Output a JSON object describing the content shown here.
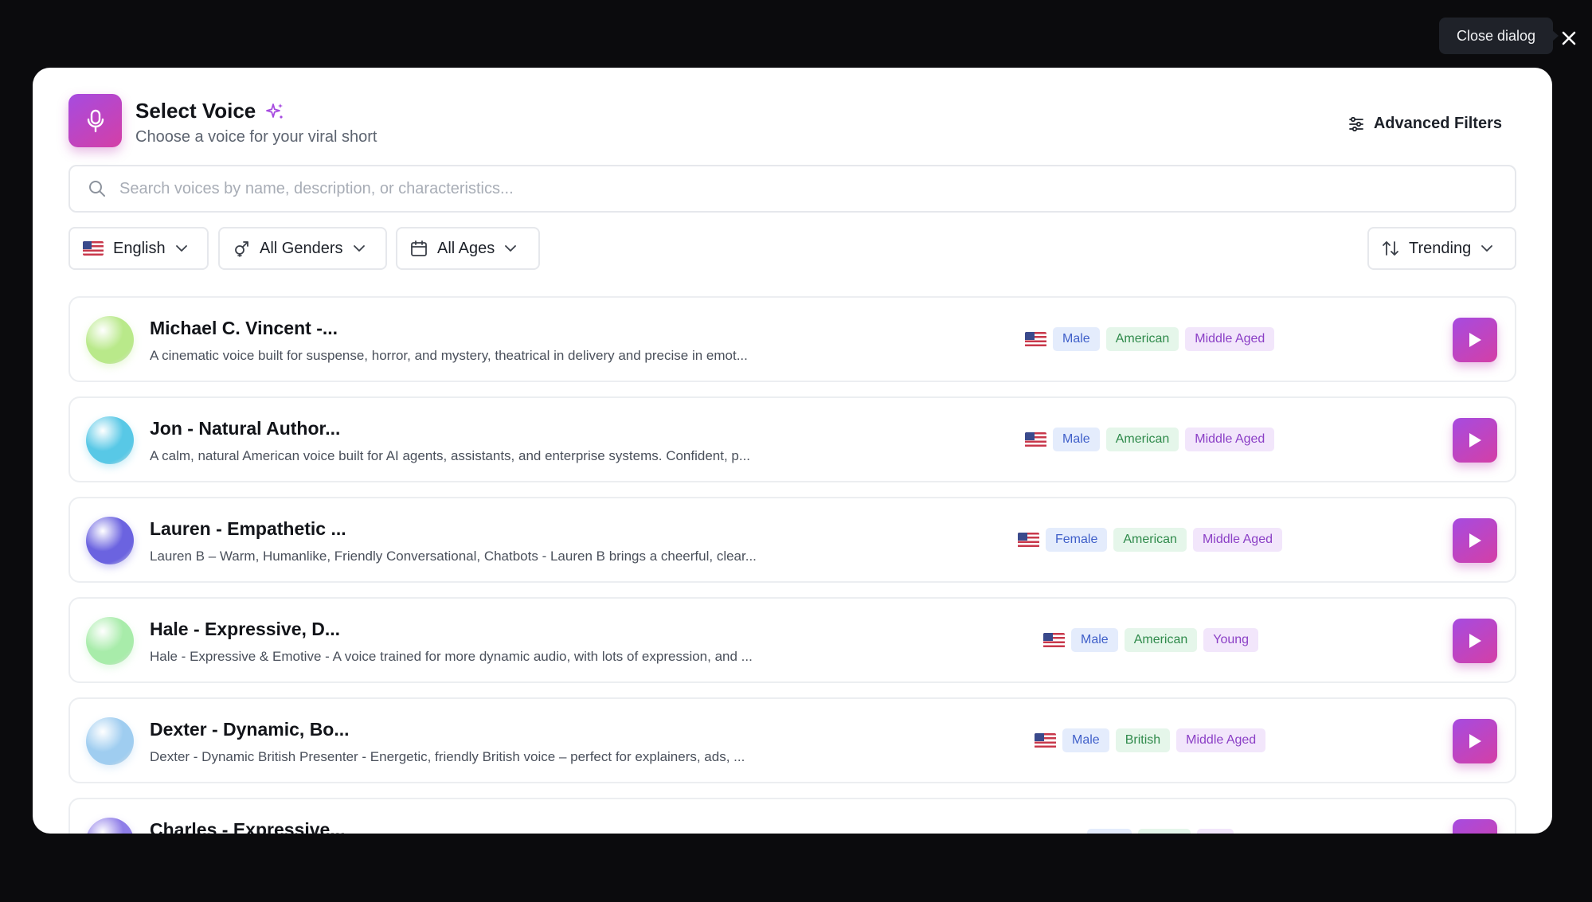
{
  "close": {
    "tooltip": "Close dialog"
  },
  "header": {
    "title": "Select Voice",
    "subtitle": "Choose a voice for your viral short",
    "advanced_filters": "Advanced Filters"
  },
  "search": {
    "placeholder": "Search voices by name, description, or characteristics..."
  },
  "filters": {
    "language": "English",
    "gender": "All Genders",
    "age": "All Ages",
    "sort": "Trending"
  },
  "colors": {
    "accent_start": "#a64be0",
    "accent_end": "#d43fa6"
  },
  "voices": [
    {
      "name": "Michael C. Vincent -...",
      "description": "A cinematic voice built for suspense, horror, and mystery, theatrical in delivery and precise in emot...",
      "gender": "Male",
      "accent": "American",
      "age": "Middle Aged",
      "avatar_color": "#b9e98a"
    },
    {
      "name": "Jon - Natural Author...",
      "description": "A calm, natural American voice built for AI agents, assistants, and enterprise systems. Confident, p...",
      "gender": "Male",
      "accent": "American",
      "age": "Middle Aged",
      "avatar_color": "#58c8e6"
    },
    {
      "name": "Lauren - Empathetic ...",
      "description": "Lauren B – Warm, Humanlike, Friendly Conversational, Chatbots - Lauren B brings a cheerful, clear...",
      "gender": "Female",
      "accent": "American",
      "age": "Middle Aged",
      "avatar_color": "#6b63e0"
    },
    {
      "name": "Hale - Expressive, D...",
      "description": "Hale - Expressive & Emotive - A voice trained for more dynamic audio, with lots of expression, and ...",
      "gender": "Male",
      "accent": "American",
      "age": "Young",
      "avatar_color": "#a8ecaa"
    },
    {
      "name": "Dexter - Dynamic, Bo...",
      "description": "Dexter - Dynamic British Presenter - Energetic, friendly British voice – perfect for explainers, ads, ...",
      "gender": "Male",
      "accent": "British",
      "age": "Middle Aged",
      "avatar_color": "#9fcdf0"
    },
    {
      "name": "Charles - Expressive...",
      "description": "",
      "gender": "",
      "accent": "",
      "age": "",
      "avatar_color": "#8f7ee8"
    }
  ]
}
